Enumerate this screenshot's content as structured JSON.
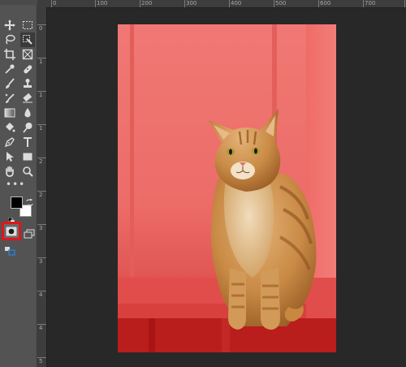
{
  "rulers": {
    "top": [
      "0",
      "100",
      "200",
      "300",
      "400",
      "500",
      "600",
      "700",
      "800"
    ],
    "left": [
      "0",
      "1",
      "1",
      "1",
      "2",
      "2",
      "3",
      "3",
      "4",
      "4",
      "5"
    ]
  },
  "toolbar": {
    "tools": [
      "move-tool",
      "marquee-tool",
      "lasso-tool",
      "quick-selection-tool",
      "crop-tool",
      "frame-tool",
      "eyedropper-tool",
      "healing-brush-tool",
      "brush-tool",
      "clone-stamp-tool",
      "history-brush-tool",
      "eraser-tool",
      "gradient-tool",
      "blur-tool",
      "dodge-tool",
      "pen-tool",
      "type-tool",
      "path-selection-tool",
      "rectangle-tool",
      "hand-tool",
      "zoom-tool"
    ],
    "more_label": "•••",
    "foreground_color": "#000000",
    "background_color": "#ffffff",
    "active_tool": "quick-mask-mode",
    "highlight_color": "#e0151a"
  },
  "document": {
    "content": "photo-of-orange-tabby-cat-with-red-quick-mask-overlay",
    "mask_overlay_color": "#ff0000"
  }
}
